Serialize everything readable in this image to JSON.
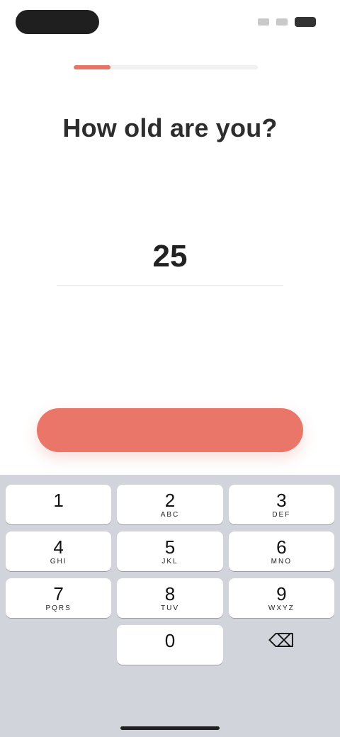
{
  "status_bar": {
    "pill_color": "#1f1f1f"
  },
  "progress": {
    "value_percent": 20,
    "fill_color": "#e97466"
  },
  "header": {
    "title": "How old are you?"
  },
  "age_input": {
    "value": "25",
    "hint": ""
  },
  "continue_button": {
    "label": "",
    "color": "#e97668"
  },
  "keyboard": {
    "keys": [
      {
        "num": "1",
        "letters": ""
      },
      {
        "num": "2",
        "letters": "ABC"
      },
      {
        "num": "3",
        "letters": "DEF"
      },
      {
        "num": "4",
        "letters": "GHI"
      },
      {
        "num": "5",
        "letters": "JKL"
      },
      {
        "num": "6",
        "letters": "MNO"
      },
      {
        "num": "7",
        "letters": "PQRS"
      },
      {
        "num": "8",
        "letters": "TUV"
      },
      {
        "num": "9",
        "letters": "WXYZ"
      },
      {
        "num": "",
        "letters": ""
      },
      {
        "num": "0",
        "letters": ""
      },
      {
        "num": "⌫",
        "letters": ""
      }
    ]
  }
}
